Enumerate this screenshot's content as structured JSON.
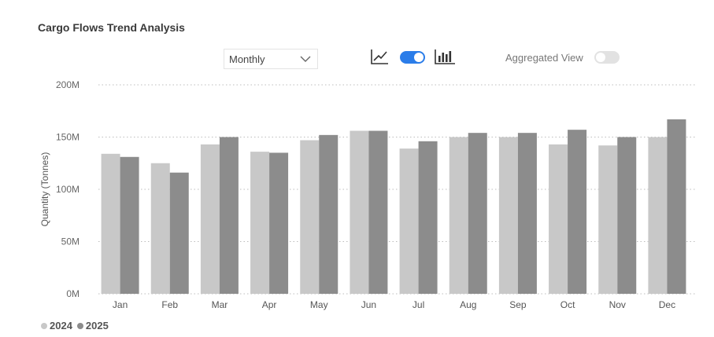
{
  "title": "Cargo Flows Trend Analysis",
  "controls": {
    "period_select": "Monthly",
    "line_chart_icon": "line-chart-icon",
    "bar_chart_icon": "bar-chart-icon",
    "chart_toggle_on": true,
    "aggregated_view_label": "Aggregated View",
    "aggregated_view_on": false
  },
  "colors": {
    "series_2024": "#c8c8c8",
    "series_2025": "#8c8c8c",
    "toggle_on": "#2b7de9",
    "toggle_off": "#e2e2e2"
  },
  "chart_data": {
    "type": "bar",
    "ylabel": "Quantity (Tonnes)",
    "categories": [
      "Jan",
      "Feb",
      "Mar",
      "Apr",
      "May",
      "Jun",
      "Jul",
      "Aug",
      "Sep",
      "Oct",
      "Nov",
      "Dec"
    ],
    "series": [
      {
        "name": "2024",
        "values": [
          134,
          125,
          143,
          136,
          147,
          156,
          139,
          150,
          150,
          143,
          142,
          150
        ]
      },
      {
        "name": "2025",
        "values": [
          131,
          116,
          150,
          135,
          152,
          156,
          146,
          154,
          154,
          157,
          150,
          167
        ]
      }
    ],
    "yticks": [
      {
        "value": 0,
        "label": "0M"
      },
      {
        "value": 50,
        "label": "50M"
      },
      {
        "value": 100,
        "label": "100M"
      },
      {
        "value": 150,
        "label": "150M"
      },
      {
        "value": 200,
        "label": "200M"
      }
    ],
    "ylim": [
      0,
      200
    ],
    "grid": true,
    "legend": "bottom-left"
  }
}
